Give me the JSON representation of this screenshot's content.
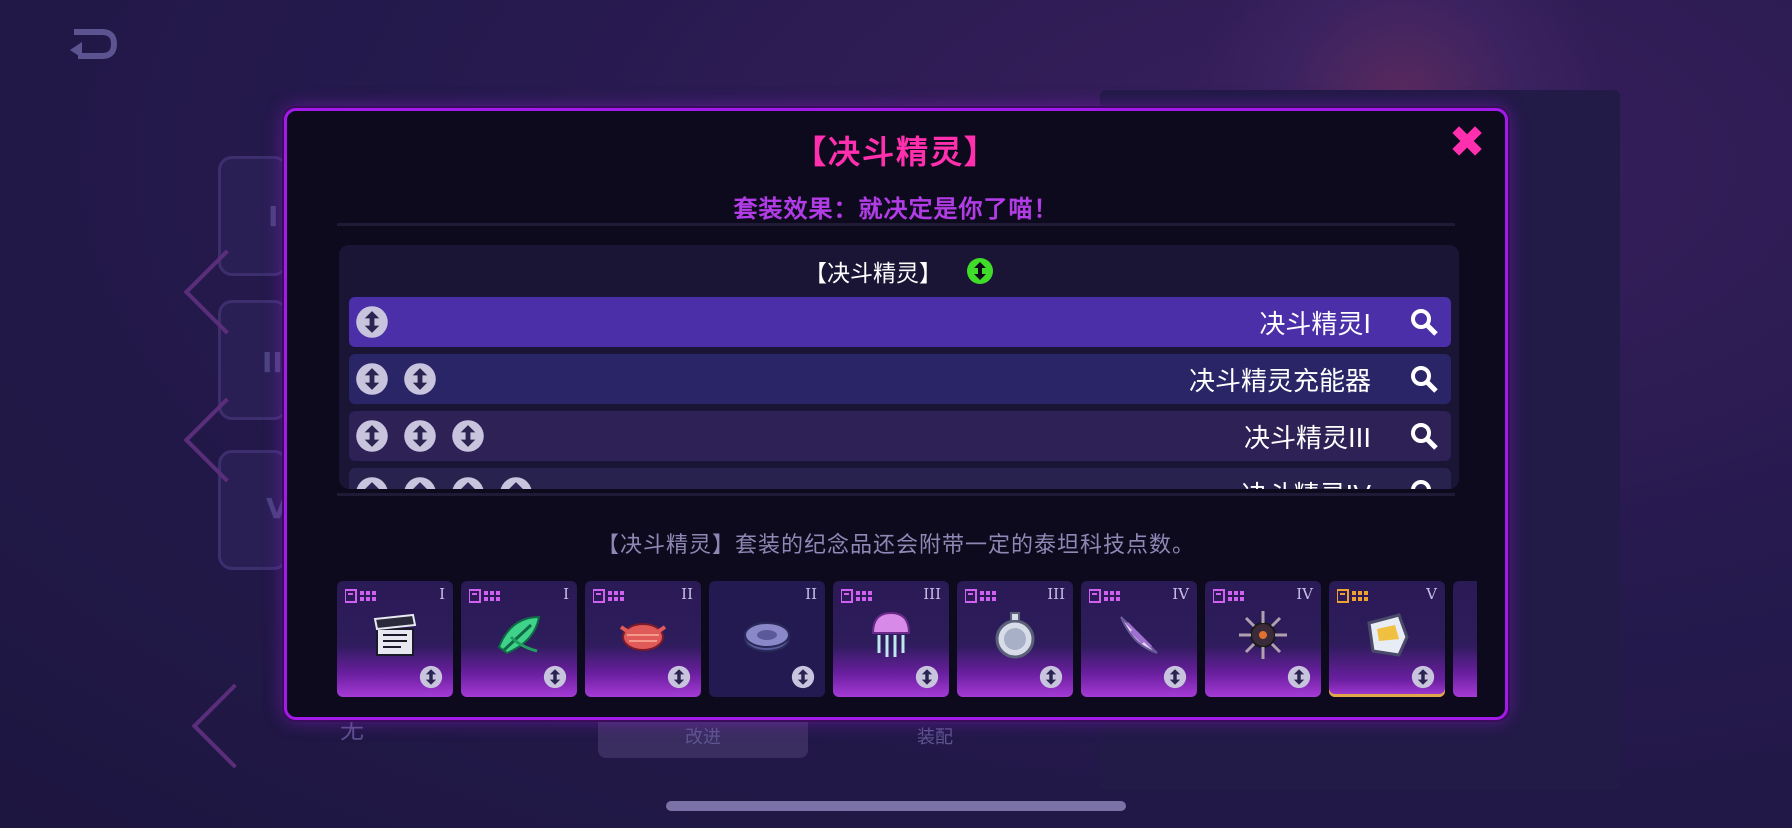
{
  "modal": {
    "title": "【决斗精灵】",
    "close_glyph": "✖",
    "set_effect": "套装效果：就决定是你了喵！",
    "tier_header": "【决斗精灵】",
    "tiers": [
      {
        "label": "决斗精灵I",
        "chips": 1
      },
      {
        "label": "决斗精灵充能器",
        "chips": 2
      },
      {
        "label": "决斗精灵III",
        "chips": 3
      },
      {
        "label": "决斗精灵IV",
        "chips": 4
      }
    ],
    "description": "【决斗精灵】套装的纪念品还会附带一定的泰坦科技点数。"
  },
  "items": [
    {
      "tier": "I",
      "icon": "clapperboard-icon",
      "style": "purple"
    },
    {
      "tier": "I",
      "icon": "leaf-icon",
      "style": "purple"
    },
    {
      "tier": "II",
      "icon": "red-crab-icon",
      "style": "purple"
    },
    {
      "tier": "II",
      "icon": "disc-icon",
      "style": "dark"
    },
    {
      "tier": "III",
      "icon": "jellyfish-icon",
      "style": "purple"
    },
    {
      "tier": "III",
      "icon": "pocket-watch-icon",
      "style": "purple"
    },
    {
      "tier": "IV",
      "icon": "seashell-icon",
      "style": "purple"
    },
    {
      "tier": "IV",
      "icon": "spiky-mine-icon",
      "style": "purple"
    },
    {
      "tier": "V",
      "icon": "armor-gauntlet-icon",
      "style": "gold"
    }
  ],
  "background": {
    "bottom_left_text": "无",
    "btn_left": "改进",
    "btn_right": "装配",
    "roman_1": "I",
    "roman_2": "II",
    "roman_3": "V"
  },
  "colors": {
    "accent_pink": "#ff2fae",
    "modal_border": "#a31bea",
    "chip_green": "#3fdc2a"
  }
}
